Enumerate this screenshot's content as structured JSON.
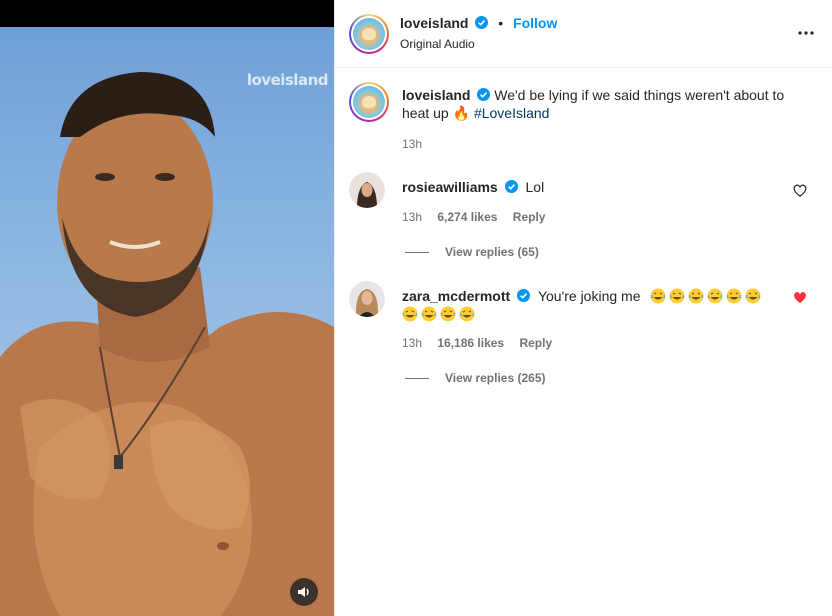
{
  "media": {
    "watermark": "loveisland",
    "mute_icon": "speaker-icon"
  },
  "post": {
    "username": "loveisland",
    "follow_label": "Follow",
    "dot": "•",
    "audio_label": "Original Audio",
    "more_icon": "more-options-icon"
  },
  "caption": {
    "username": "loveisland",
    "text": "We'd be lying if we said things weren't about to heat up",
    "emoji": "🔥",
    "hashtag": "#LoveIsland",
    "time": "13h"
  },
  "comments": [
    {
      "username": "rosieawilliams",
      "text": "Lol",
      "time": "13h",
      "likes": "6,274 likes",
      "reply_label": "Reply",
      "view_replies": "View replies (65)",
      "liked": false
    },
    {
      "username": "zara_mcdermott",
      "text": "You're joking me",
      "emoji_count": 10,
      "time": "13h",
      "likes": "16,186 likes",
      "reply_label": "Reply",
      "view_replies": "View replies (265)",
      "liked": true
    }
  ],
  "colors": {
    "accent": "#0095f6",
    "hashtag": "#00376b",
    "heart_liked": "#ff3040",
    "muted": "#737373"
  }
}
